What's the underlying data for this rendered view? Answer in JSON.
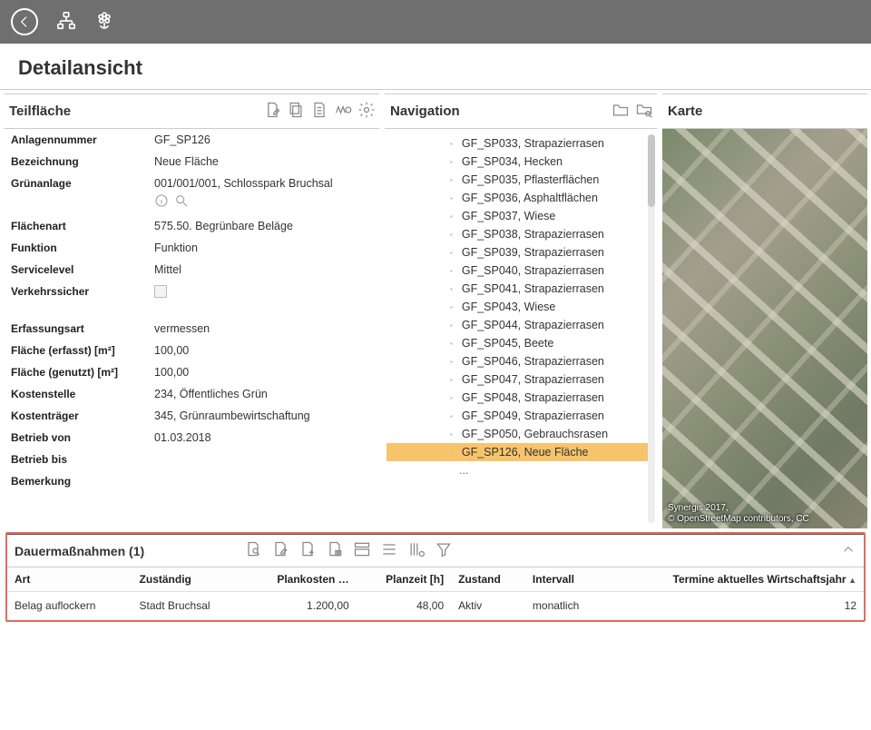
{
  "page": {
    "title": "Detailansicht"
  },
  "teil": {
    "heading": "Teilfläche",
    "props": {
      "anlagennummer_label": "Anlagennummer",
      "anlagennummer_value": "GF_SP126",
      "bezeichnung_label": "Bezeichnung",
      "bezeichnung_value": "Neue Fläche",
      "gruenanlage_label": "Grünanlage",
      "gruenanlage_value": "001/001/001, Schlosspark Bruchsal",
      "flaechenart_label": "Flächenart",
      "flaechenart_value": "575.50. Begrünbare Beläge",
      "funktion_label": "Funktion",
      "funktion_value": "Funktion",
      "servicelevel_label": "Servicelevel",
      "servicelevel_value": "Mittel",
      "verkehrssicher_label": "Verkehrssicher",
      "erfassungsart_label": "Erfassungsart",
      "erfassungsart_value": "vermessen",
      "flaeche_erf_label": "Fläche (erfasst) [m²]",
      "flaeche_erf_value": "100,00",
      "flaeche_gen_label": "Fläche (genutzt) [m²]",
      "flaeche_gen_value": "100,00",
      "kostenstelle_label": "Kostenstelle",
      "kostenstelle_value": "234, Öffentliches Grün",
      "kostentraeger_label": "Kostenträger",
      "kostentraeger_value": "345, Grünraumbewirtschaftung",
      "betrieb_von_label": "Betrieb von",
      "betrieb_von_value": "01.03.2018",
      "betrieb_bis_label": "Betrieb bis",
      "betrieb_bis_value": "",
      "bemerkung_label": "Bemerkung",
      "bemerkung_value": ""
    }
  },
  "navigation": {
    "heading": "Navigation",
    "items": [
      {
        "label": "GF_SP033, Strapazierrasen",
        "selected": false
      },
      {
        "label": "GF_SP034, Hecken",
        "selected": false
      },
      {
        "label": "GF_SP035, Pflasterflächen",
        "selected": false
      },
      {
        "label": "GF_SP036, Asphaltflächen",
        "selected": false
      },
      {
        "label": "GF_SP037, Wiese",
        "selected": false
      },
      {
        "label": "GF_SP038, Strapazierrasen",
        "selected": false
      },
      {
        "label": "GF_SP039, Strapazierrasen",
        "selected": false
      },
      {
        "label": "GF_SP040, Strapazierrasen",
        "selected": false
      },
      {
        "label": "GF_SP041, Strapazierrasen",
        "selected": false
      },
      {
        "label": "GF_SP043, Wiese",
        "selected": false
      },
      {
        "label": "GF_SP044, Strapazierrasen",
        "selected": false
      },
      {
        "label": "GF_SP045, Beete",
        "selected": false
      },
      {
        "label": "GF_SP046, Strapazierrasen",
        "selected": false
      },
      {
        "label": "GF_SP047, Strapazierrasen",
        "selected": false
      },
      {
        "label": "GF_SP048, Strapazierrasen",
        "selected": false
      },
      {
        "label": "GF_SP049, Strapazierrasen",
        "selected": false
      },
      {
        "label": "GF_SP050, Gebrauchsrasen",
        "selected": false
      },
      {
        "label": "GF_SP126, Neue Fläche",
        "selected": true
      }
    ],
    "ellipsis": "..."
  },
  "karte": {
    "heading": "Karte",
    "credit_line1": "Synergis 2017,",
    "credit_line2": "© OpenStreetMap contributors, CC"
  },
  "dauer": {
    "heading": "Dauermaßnahmen (1)",
    "columns": {
      "art": "Art",
      "zust": "Zuständig",
      "plank": "Plankosten …",
      "planz": "Planzeit [h]",
      "zustand": "Zustand",
      "intervall": "Intervall",
      "termine": "Termine aktuelles Wirtschaftsjahr"
    },
    "rows": [
      {
        "art": "Belag auflockern",
        "zust": "Stadt Bruchsal",
        "plank": "1.200,00",
        "planz": "48,00",
        "zustand": "Aktiv",
        "intervall": "monatlich",
        "termine": "12"
      }
    ]
  }
}
